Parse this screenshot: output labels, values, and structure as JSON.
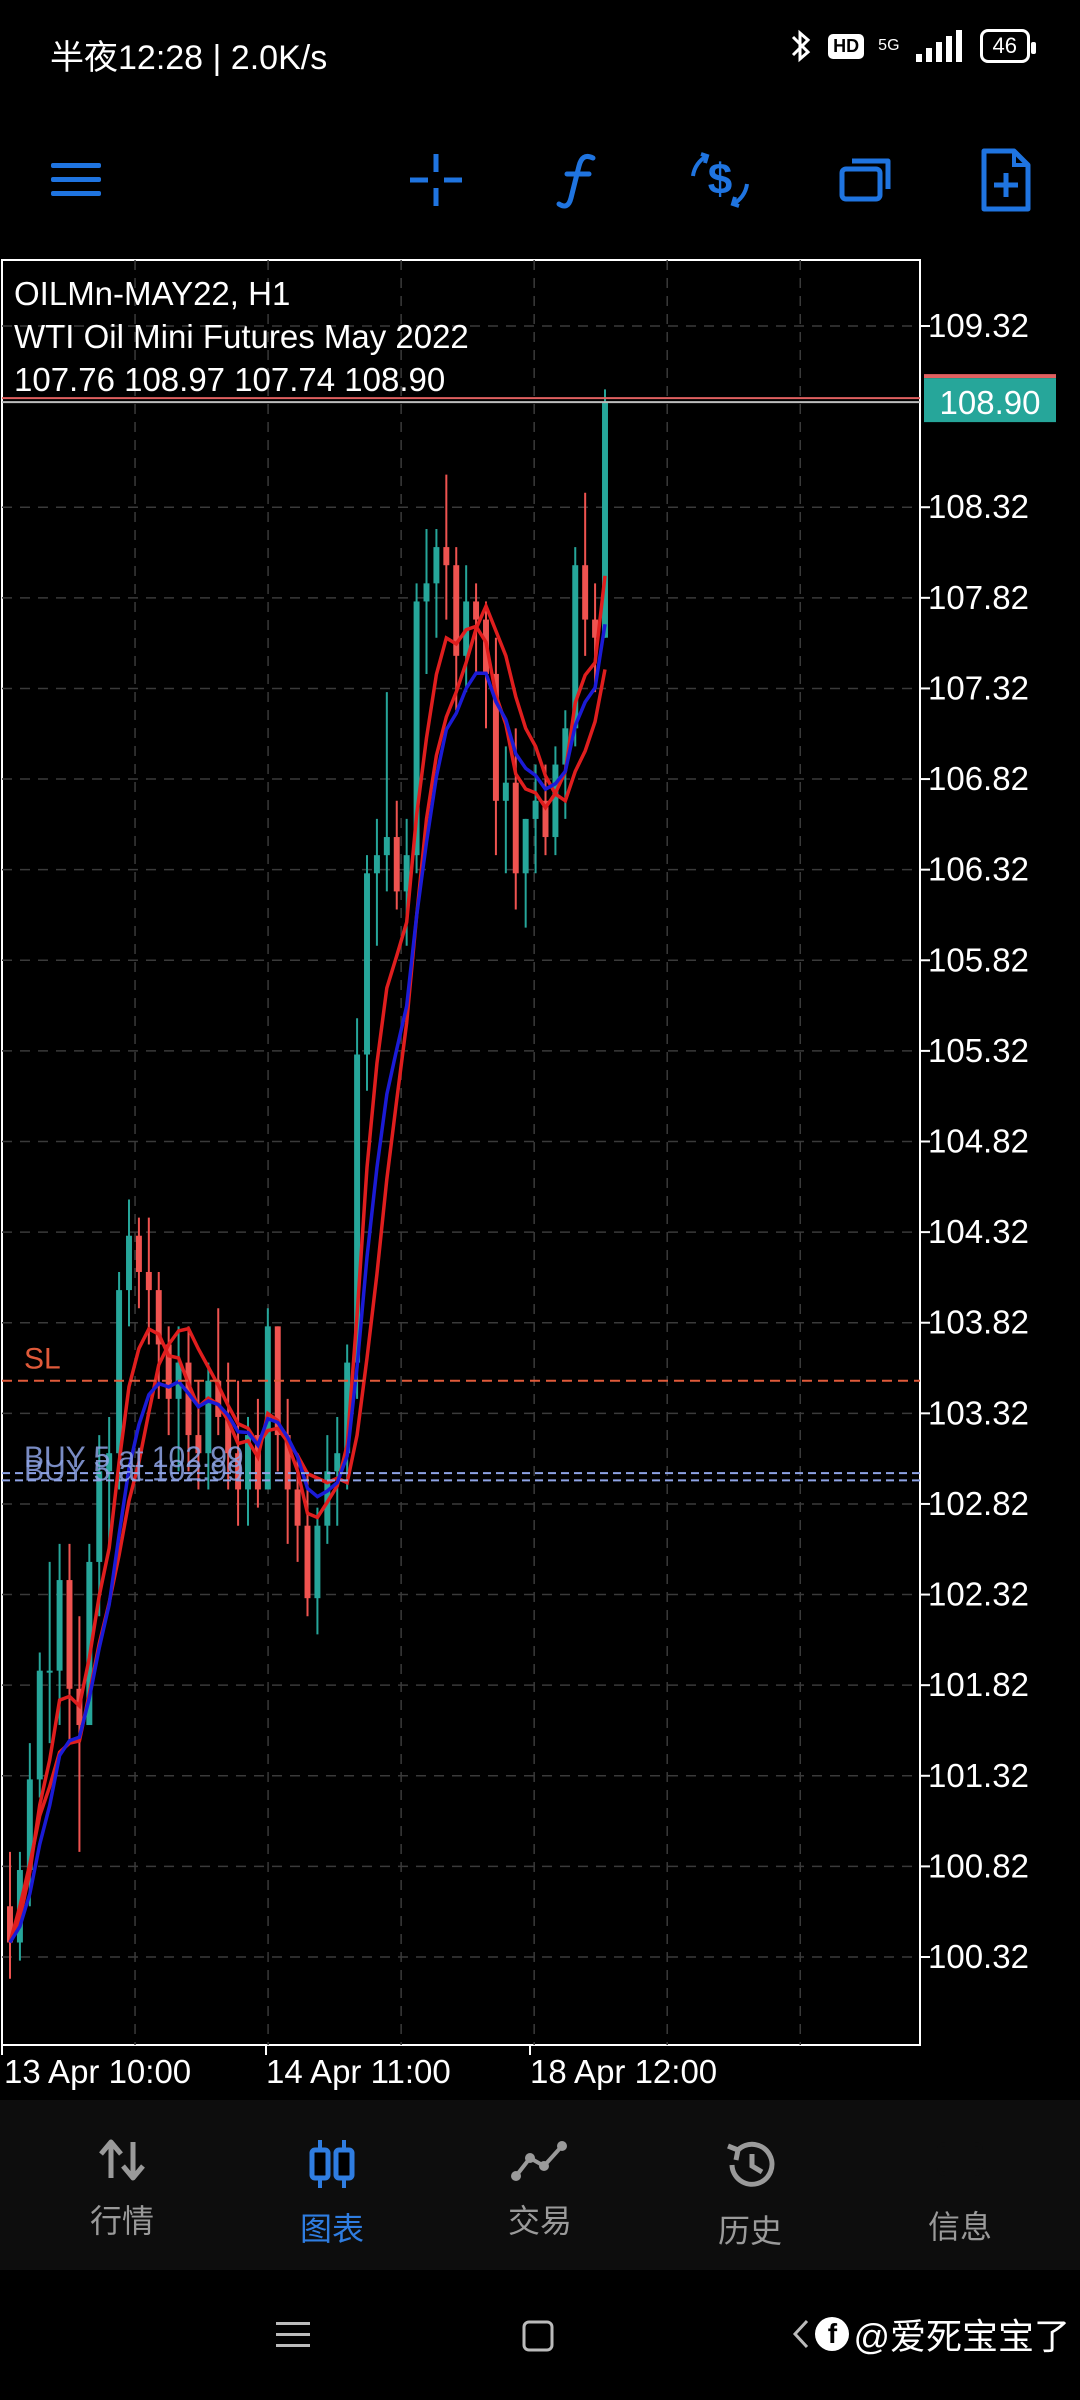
{
  "status_bar": {
    "time": "半夜12:28 | 2.0K/s",
    "hd": "HD",
    "net": "5G",
    "battery": "46",
    "icons": [
      "bluetooth-icon",
      "hd-icon",
      "signal-icon",
      "battery-icon"
    ]
  },
  "toolbar": {
    "icons": [
      "menu-icon",
      "crosshair-icon",
      "indicator-function-icon",
      "symbol-change-icon",
      "timeframe-windows-icon",
      "new-order-icon"
    ]
  },
  "colors": {
    "accent": "#1f74e0",
    "up_candle": "#26a69a",
    "down_candle": "#ef5350",
    "ma_red": "#e01e1e",
    "ma_blue": "#1b1bd6",
    "sl_line": "#e05a3a",
    "buy_line": "#8fa4e6",
    "price_tag": "#26a69a",
    "grid": "#3a3a3a"
  },
  "chart_info": {
    "symbol": "OILMn-MAY22, H1",
    "description": "WTI Oil Mini Futures May 2022",
    "ohlc": "107.76 108.97 107.74 108.90"
  },
  "chart_data": {
    "type": "candlestick",
    "symbol": "OILMn-MAY22",
    "timeframe": "H1",
    "y_ticks": [
      "109.32",
      "108.32",
      "107.82",
      "107.32",
      "106.82",
      "106.32",
      "105.82",
      "105.32",
      "104.82",
      "104.32",
      "103.82",
      "103.32",
      "102.82",
      "102.32",
      "101.82",
      "101.32",
      "100.82",
      "100.32"
    ],
    "x_ticks": [
      "13 Apr 10:00",
      "14 Apr 11:00",
      "18 Apr 12:00"
    ],
    "ylim": [
      99.85,
      109.7
    ],
    "current_price": "108.90",
    "sl_label": "SL",
    "sl_price": 103.5,
    "buy_labels": [
      "BUY 5 at 102.99",
      "BUY 5 at 102.99"
    ],
    "buy_prices": [
      102.99,
      102.95
    ],
    "candles": [
      {
        "o": 100.6,
        "h": 100.9,
        "l": 100.2,
        "c": 100.4
      },
      {
        "o": 100.4,
        "h": 100.9,
        "l": 100.3,
        "c": 100.8
      },
      {
        "o": 100.8,
        "h": 101.5,
        "l": 100.6,
        "c": 101.3
      },
      {
        "o": 101.3,
        "h": 102.0,
        "l": 101.2,
        "c": 101.9
      },
      {
        "o": 101.9,
        "h": 102.5,
        "l": 101.5,
        "c": 101.9
      },
      {
        "o": 101.9,
        "h": 102.6,
        "l": 101.6,
        "c": 102.4
      },
      {
        "o": 102.4,
        "h": 102.6,
        "l": 101.5,
        "c": 101.8
      },
      {
        "o": 101.8,
        "h": 102.2,
        "l": 100.9,
        "c": 101.6
      },
      {
        "o": 101.6,
        "h": 102.6,
        "l": 101.6,
        "c": 102.5
      },
      {
        "o": 102.5,
        "h": 103.2,
        "l": 102.2,
        "c": 103.0
      },
      {
        "o": 103.0,
        "h": 103.3,
        "l": 102.6,
        "c": 103.1
      },
      {
        "o": 103.1,
        "h": 104.1,
        "l": 102.9,
        "c": 104.0
      },
      {
        "o": 104.0,
        "h": 104.5,
        "l": 103.8,
        "c": 104.3
      },
      {
        "o": 104.3,
        "h": 104.4,
        "l": 103.9,
        "c": 104.1
      },
      {
        "o": 104.1,
        "h": 104.4,
        "l": 103.7,
        "c": 104.0
      },
      {
        "o": 104.0,
        "h": 104.1,
        "l": 103.4,
        "c": 103.7
      },
      {
        "o": 103.7,
        "h": 103.8,
        "l": 103.2,
        "c": 103.4
      },
      {
        "o": 103.4,
        "h": 103.8,
        "l": 103.0,
        "c": 103.6
      },
      {
        "o": 103.6,
        "h": 103.8,
        "l": 103.0,
        "c": 103.2
      },
      {
        "o": 103.2,
        "h": 103.5,
        "l": 102.9,
        "c": 103.1
      },
      {
        "o": 103.1,
        "h": 103.6,
        "l": 102.9,
        "c": 103.5
      },
      {
        "o": 103.5,
        "h": 103.9,
        "l": 103.2,
        "c": 103.3
      },
      {
        "o": 103.3,
        "h": 103.6,
        "l": 102.9,
        "c": 103.1
      },
      {
        "o": 103.1,
        "h": 103.5,
        "l": 102.7,
        "c": 102.9
      },
      {
        "o": 102.9,
        "h": 103.3,
        "l": 102.7,
        "c": 103.2
      },
      {
        "o": 103.2,
        "h": 103.4,
        "l": 102.8,
        "c": 102.9
      },
      {
        "o": 102.9,
        "h": 103.9,
        "l": 102.9,
        "c": 103.8
      },
      {
        "o": 103.8,
        "h": 103.8,
        "l": 103.0,
        "c": 103.2
      },
      {
        "o": 103.2,
        "h": 103.4,
        "l": 102.6,
        "c": 102.9
      },
      {
        "o": 102.9,
        "h": 103.1,
        "l": 102.5,
        "c": 102.7
      },
      {
        "o": 102.7,
        "h": 103.0,
        "l": 102.2,
        "c": 102.3
      },
      {
        "o": 102.3,
        "h": 102.8,
        "l": 102.1,
        "c": 102.7
      },
      {
        "o": 102.7,
        "h": 103.2,
        "l": 102.6,
        "c": 103.0
      },
      {
        "o": 103.0,
        "h": 103.3,
        "l": 102.7,
        "c": 103.1
      },
      {
        "o": 103.1,
        "h": 103.7,
        "l": 102.9,
        "c": 103.6
      },
      {
        "o": 103.6,
        "h": 105.5,
        "l": 103.4,
        "c": 105.3
      },
      {
        "o": 105.3,
        "h": 106.4,
        "l": 105.1,
        "c": 106.3
      },
      {
        "o": 106.3,
        "h": 106.6,
        "l": 105.9,
        "c": 106.4
      },
      {
        "o": 106.4,
        "h": 107.3,
        "l": 106.2,
        "c": 106.5
      },
      {
        "o": 106.5,
        "h": 106.7,
        "l": 106.1,
        "c": 106.2
      },
      {
        "o": 106.2,
        "h": 106.6,
        "l": 105.9,
        "c": 106.4
      },
      {
        "o": 106.4,
        "h": 107.9,
        "l": 106.3,
        "c": 107.8
      },
      {
        "o": 107.8,
        "h": 108.2,
        "l": 107.4,
        "c": 107.9
      },
      {
        "o": 107.9,
        "h": 108.2,
        "l": 107.6,
        "c": 108.1
      },
      {
        "o": 108.1,
        "h": 108.5,
        "l": 107.7,
        "c": 108.0
      },
      {
        "o": 108.0,
        "h": 108.1,
        "l": 107.2,
        "c": 107.5
      },
      {
        "o": 107.5,
        "h": 108.0,
        "l": 107.3,
        "c": 107.8
      },
      {
        "o": 107.8,
        "h": 107.9,
        "l": 107.4,
        "c": 107.7
      },
      {
        "o": 107.7,
        "h": 107.8,
        "l": 107.1,
        "c": 107.4
      },
      {
        "o": 107.4,
        "h": 107.6,
        "l": 106.4,
        "c": 106.7
      },
      {
        "o": 106.7,
        "h": 107.0,
        "l": 106.3,
        "c": 106.8
      },
      {
        "o": 106.8,
        "h": 107.1,
        "l": 106.1,
        "c": 106.3
      },
      {
        "o": 106.3,
        "h": 106.6,
        "l": 106.0,
        "c": 106.6
      },
      {
        "o": 106.6,
        "h": 106.9,
        "l": 106.3,
        "c": 106.7
      },
      {
        "o": 106.7,
        "h": 106.9,
        "l": 106.4,
        "c": 106.5
      },
      {
        "o": 106.5,
        "h": 107.0,
        "l": 106.4,
        "c": 106.9
      },
      {
        "o": 106.9,
        "h": 107.2,
        "l": 106.6,
        "c": 107.1
      },
      {
        "o": 107.1,
        "h": 108.1,
        "l": 107.0,
        "c": 108.0
      },
      {
        "o": 108.0,
        "h": 108.4,
        "l": 107.5,
        "c": 107.7
      },
      {
        "o": 107.7,
        "h": 107.9,
        "l": 107.3,
        "c": 107.6
      },
      {
        "o": 107.6,
        "h": 108.97,
        "l": 107.6,
        "c": 108.9
      }
    ]
  },
  "bottom_nav": {
    "items": [
      {
        "label": "行情",
        "icon": "quotes-icon"
      },
      {
        "label": "图表",
        "icon": "chart-icon"
      },
      {
        "label": "交易",
        "icon": "trade-icon"
      },
      {
        "label": "历史",
        "icon": "history-icon"
      },
      {
        "label": "信息",
        "icon": "messages-icon"
      }
    ],
    "active": "图表"
  },
  "watermark": "@爱死宝宝了"
}
